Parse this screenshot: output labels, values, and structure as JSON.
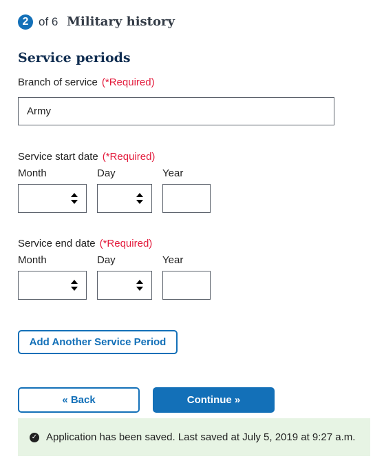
{
  "header": {
    "step": "2",
    "of": "of 6",
    "title": "Military history"
  },
  "section_title": "Service periods",
  "branch": {
    "label": "Branch of service",
    "required": "(*Required)",
    "value": "Army"
  },
  "start_date": {
    "label": "Service start date",
    "required": "(*Required)",
    "month_label": "Month",
    "day_label": "Day",
    "year_label": "Year",
    "month": "",
    "day": "",
    "year": ""
  },
  "end_date": {
    "label": "Service end date",
    "required": "(*Required)",
    "month_label": "Month",
    "day_label": "Day",
    "year_label": "Year",
    "month": "",
    "day": "",
    "year": ""
  },
  "buttons": {
    "add": "Add Another Service Period",
    "back": "« Back",
    "continue": "Continue »"
  },
  "banner": {
    "icon": "check-circle-icon",
    "text": "Application has been saved. Last saved at July 5, 2019 at 9:27 a.m."
  },
  "colors": {
    "primary": "#1370b8",
    "required": "#e31c3d",
    "success_bg": "#e7f4e4"
  }
}
